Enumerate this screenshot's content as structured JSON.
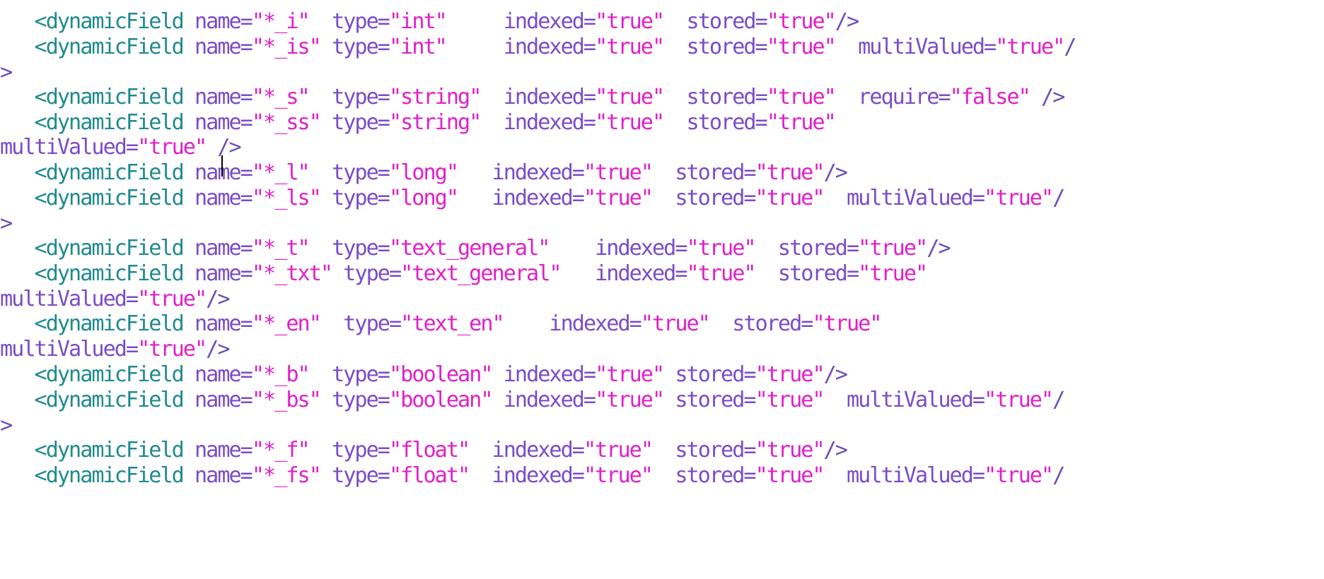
{
  "editor": {
    "lines": [
      {
        "tokens": [
          {
            "t": "   ",
            "c": "plain"
          },
          {
            "t": "<dynamicField",
            "c": "tag"
          },
          {
            "t": " name=",
            "c": "attr"
          },
          {
            "t": "\"*_i\"",
            "c": "val"
          },
          {
            "t": "  type=",
            "c": "attr"
          },
          {
            "t": "\"int\"",
            "c": "val"
          },
          {
            "t": "     indexed=",
            "c": "attr"
          },
          {
            "t": "\"true\"",
            "c": "val"
          },
          {
            "t": "  stored=",
            "c": "attr"
          },
          {
            "t": "\"true\"",
            "c": "val"
          },
          {
            "t": "/>",
            "c": "punct"
          }
        ]
      },
      {
        "tokens": [
          {
            "t": "   ",
            "c": "plain"
          },
          {
            "t": "<dynamicField",
            "c": "tag"
          },
          {
            "t": " name=",
            "c": "attr"
          },
          {
            "t": "\"*_is\"",
            "c": "val"
          },
          {
            "t": " type=",
            "c": "attr"
          },
          {
            "t": "\"int\"",
            "c": "val"
          },
          {
            "t": "     indexed=",
            "c": "attr"
          },
          {
            "t": "\"true\"",
            "c": "val"
          },
          {
            "t": "  stored=",
            "c": "attr"
          },
          {
            "t": "\"true\"",
            "c": "val"
          },
          {
            "t": "  multiValued=",
            "c": "attr"
          },
          {
            "t": "\"true\"",
            "c": "val"
          },
          {
            "t": "/",
            "c": "punct"
          }
        ]
      },
      {
        "tokens": [
          {
            "t": ">",
            "c": "punct"
          }
        ]
      },
      {
        "tokens": [
          {
            "t": "   ",
            "c": "plain"
          },
          {
            "t": "<dynamicField",
            "c": "tag"
          },
          {
            "t": " name=",
            "c": "attr"
          },
          {
            "t": "\"*_s\"",
            "c": "val"
          },
          {
            "t": "  type=",
            "c": "attr"
          },
          {
            "t": "\"string\"",
            "c": "val"
          },
          {
            "t": "  indexed=",
            "c": "attr"
          },
          {
            "t": "\"true\"",
            "c": "val"
          },
          {
            "t": "  stored=",
            "c": "attr"
          },
          {
            "t": "\"true\"",
            "c": "val"
          },
          {
            "t": "  require=",
            "c": "attr"
          },
          {
            "t": "\"false\"",
            "c": "val"
          },
          {
            "t": " />",
            "c": "punct"
          }
        ]
      },
      {
        "tokens": [
          {
            "t": "   ",
            "c": "plain"
          },
          {
            "t": "<dynamicField",
            "c": "tag"
          },
          {
            "t": " name=",
            "c": "attr"
          },
          {
            "t": "\"*_ss\"",
            "c": "val"
          },
          {
            "t": " type=",
            "c": "attr"
          },
          {
            "t": "\"string\"",
            "c": "val"
          },
          {
            "t": "  indexed=",
            "c": "attr"
          },
          {
            "t": "\"true\"",
            "c": "val"
          },
          {
            "t": "  stored=",
            "c": "attr"
          },
          {
            "t": "\"true\"",
            "c": "val"
          }
        ]
      },
      {
        "tokens": [
          {
            "t": "multiValued=",
            "c": "attr"
          },
          {
            "t": "\"true\"",
            "c": "val"
          },
          {
            "t": " />",
            "c": "punct"
          }
        ]
      },
      {
        "tokens": [
          {
            "t": "   ",
            "c": "plain"
          },
          {
            "t": "<dynamicField",
            "c": "tag"
          },
          {
            "t": " name=",
            "c": "attr"
          },
          {
            "t": "\"*_l\"",
            "c": "val"
          },
          {
            "t": "  type=",
            "c": "attr"
          },
          {
            "t": "\"long\"",
            "c": "val"
          },
          {
            "t": "   indexed=",
            "c": "attr"
          },
          {
            "t": "\"true\"",
            "c": "val"
          },
          {
            "t": "  stored=",
            "c": "attr"
          },
          {
            "t": "\"true\"",
            "c": "val"
          },
          {
            "t": "/>",
            "c": "punct"
          }
        ]
      },
      {
        "tokens": [
          {
            "t": "   ",
            "c": "plain"
          },
          {
            "t": "<dynamicField",
            "c": "tag"
          },
          {
            "t": " name=",
            "c": "attr"
          },
          {
            "t": "\"*_ls\"",
            "c": "val"
          },
          {
            "t": " type=",
            "c": "attr"
          },
          {
            "t": "\"long\"",
            "c": "val"
          },
          {
            "t": "   indexed=",
            "c": "attr"
          },
          {
            "t": "\"true\"",
            "c": "val"
          },
          {
            "t": "  stored=",
            "c": "attr"
          },
          {
            "t": "\"true\"",
            "c": "val"
          },
          {
            "t": "  multiValued=",
            "c": "attr"
          },
          {
            "t": "\"true\"",
            "c": "val"
          },
          {
            "t": "/",
            "c": "punct"
          }
        ]
      },
      {
        "tokens": [
          {
            "t": ">",
            "c": "punct"
          }
        ]
      },
      {
        "tokens": [
          {
            "t": "   ",
            "c": "plain"
          },
          {
            "t": "<dynamicField",
            "c": "tag"
          },
          {
            "t": " name=",
            "c": "attr"
          },
          {
            "t": "\"*_t\"",
            "c": "val"
          },
          {
            "t": "  type=",
            "c": "attr"
          },
          {
            "t": "\"text_general\"",
            "c": "val"
          },
          {
            "t": "    indexed=",
            "c": "attr"
          },
          {
            "t": "\"true\"",
            "c": "val"
          },
          {
            "t": "  stored=",
            "c": "attr"
          },
          {
            "t": "\"true\"",
            "c": "val"
          },
          {
            "t": "/>",
            "c": "punct"
          }
        ]
      },
      {
        "tokens": [
          {
            "t": "   ",
            "c": "plain"
          },
          {
            "t": "<dynamicField",
            "c": "tag"
          },
          {
            "t": " name=",
            "c": "attr"
          },
          {
            "t": "\"*_txt\"",
            "c": "val"
          },
          {
            "t": " type=",
            "c": "attr"
          },
          {
            "t": "\"text_general\"",
            "c": "val"
          },
          {
            "t": "   indexed=",
            "c": "attr"
          },
          {
            "t": "\"true\"",
            "c": "val"
          },
          {
            "t": "  stored=",
            "c": "attr"
          },
          {
            "t": "\"true\"",
            "c": "val"
          }
        ]
      },
      {
        "tokens": [
          {
            "t": "multiValued=",
            "c": "attr"
          },
          {
            "t": "\"true\"",
            "c": "val"
          },
          {
            "t": "/>",
            "c": "punct"
          }
        ]
      },
      {
        "tokens": [
          {
            "t": "   ",
            "c": "plain"
          },
          {
            "t": "<dynamicField",
            "c": "tag"
          },
          {
            "t": " name=",
            "c": "attr"
          },
          {
            "t": "\"*_en\"",
            "c": "val"
          },
          {
            "t": "  type=",
            "c": "attr"
          },
          {
            "t": "\"text_en\"",
            "c": "val"
          },
          {
            "t": "    indexed=",
            "c": "attr"
          },
          {
            "t": "\"true\"",
            "c": "val"
          },
          {
            "t": "  stored=",
            "c": "attr"
          },
          {
            "t": "\"true\"",
            "c": "val"
          }
        ]
      },
      {
        "tokens": [
          {
            "t": "multiValued=",
            "c": "attr"
          },
          {
            "t": "\"true\"",
            "c": "val"
          },
          {
            "t": "/>",
            "c": "punct"
          }
        ]
      },
      {
        "tokens": [
          {
            "t": "   ",
            "c": "plain"
          },
          {
            "t": "<dynamicField",
            "c": "tag"
          },
          {
            "t": " name=",
            "c": "attr"
          },
          {
            "t": "\"*_b\"",
            "c": "val"
          },
          {
            "t": "  type=",
            "c": "attr"
          },
          {
            "t": "\"boolean\"",
            "c": "val"
          },
          {
            "t": " indexed=",
            "c": "attr"
          },
          {
            "t": "\"true\"",
            "c": "val"
          },
          {
            "t": " stored=",
            "c": "attr"
          },
          {
            "t": "\"true\"",
            "c": "val"
          },
          {
            "t": "/>",
            "c": "punct"
          }
        ]
      },
      {
        "tokens": [
          {
            "t": "   ",
            "c": "plain"
          },
          {
            "t": "<dynamicField",
            "c": "tag"
          },
          {
            "t": " name=",
            "c": "attr"
          },
          {
            "t": "\"*_bs\"",
            "c": "val"
          },
          {
            "t": " type=",
            "c": "attr"
          },
          {
            "t": "\"boolean\"",
            "c": "val"
          },
          {
            "t": " indexed=",
            "c": "attr"
          },
          {
            "t": "\"true\"",
            "c": "val"
          },
          {
            "t": " stored=",
            "c": "attr"
          },
          {
            "t": "\"true\"",
            "c": "val"
          },
          {
            "t": "  multiValued=",
            "c": "attr"
          },
          {
            "t": "\"true\"",
            "c": "val"
          },
          {
            "t": "/",
            "c": "punct"
          }
        ]
      },
      {
        "tokens": [
          {
            "t": ">",
            "c": "punct"
          }
        ]
      },
      {
        "tokens": [
          {
            "t": "   ",
            "c": "plain"
          },
          {
            "t": "<dynamicField",
            "c": "tag"
          },
          {
            "t": " name=",
            "c": "attr"
          },
          {
            "t": "\"*_f\"",
            "c": "val"
          },
          {
            "t": "  type=",
            "c": "attr"
          },
          {
            "t": "\"float\"",
            "c": "val"
          },
          {
            "t": "  indexed=",
            "c": "attr"
          },
          {
            "t": "\"true\"",
            "c": "val"
          },
          {
            "t": "  stored=",
            "c": "attr"
          },
          {
            "t": "\"true\"",
            "c": "val"
          },
          {
            "t": "/>",
            "c": "punct"
          }
        ]
      },
      {
        "tokens": [
          {
            "t": "   ",
            "c": "plain"
          },
          {
            "t": "<dynamicField",
            "c": "tag"
          },
          {
            "t": " name=",
            "c": "attr"
          },
          {
            "t": "\"*_fs\"",
            "c": "val"
          },
          {
            "t": " type=",
            "c": "attr"
          },
          {
            "t": "\"float\"",
            "c": "val"
          },
          {
            "t": "  indexed=",
            "c": "attr"
          },
          {
            "t": "\"true\"",
            "c": "val"
          },
          {
            "t": "  stored=",
            "c": "attr"
          },
          {
            "t": "\"true\"",
            "c": "val"
          },
          {
            "t": "  multiValued=",
            "c": "attr"
          },
          {
            "t": "\"true\"",
            "c": "val"
          },
          {
            "t": "/",
            "c": "punct"
          }
        ]
      }
    ]
  },
  "colors": {
    "tag": "#1f8a8f",
    "attr": "#7a4cc8",
    "value": "#e020c8",
    "background": "#ffffff"
  }
}
